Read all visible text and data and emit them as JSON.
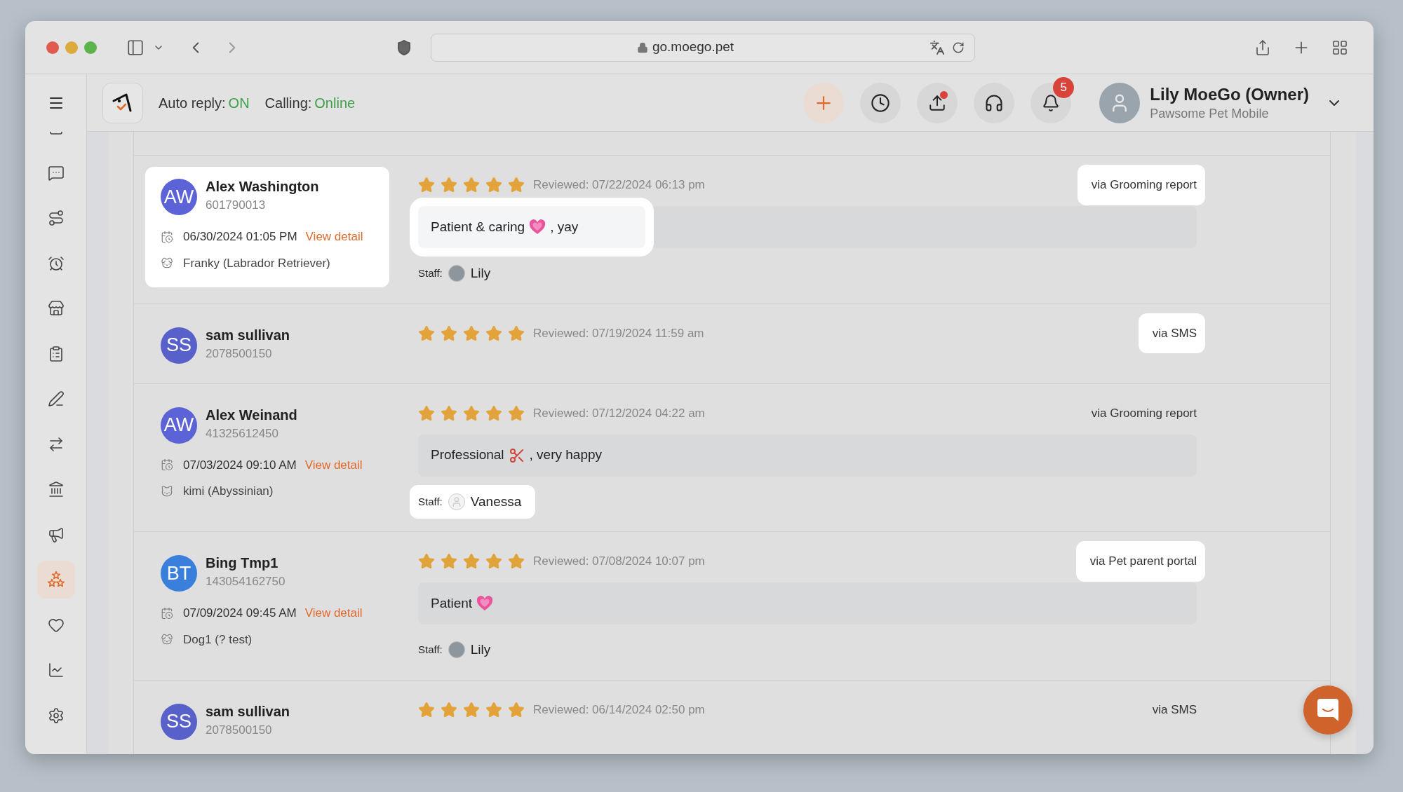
{
  "browser": {
    "url": "go.moego.pet"
  },
  "sidebar": {
    "items": [
      {
        "selected": false
      },
      {
        "selected": false
      },
      {
        "selected": false
      },
      {
        "selected": false
      },
      {
        "selected": false
      },
      {
        "selected": false
      },
      {
        "selected": false
      },
      {
        "selected": false
      },
      {
        "selected": false
      },
      {
        "selected": false
      },
      {
        "selected": true
      },
      {
        "selected": false
      },
      {
        "selected": false
      },
      {
        "selected": false
      }
    ]
  },
  "header": {
    "auto_reply": {
      "label": "Auto reply:",
      "value": "ON"
    },
    "calling": {
      "label": "Calling:",
      "value": "Online"
    },
    "upload_unread": true,
    "notifications_count": "5",
    "user": {
      "name": "Lily MoeGo (Owner)",
      "business": "Pawsome Pet Mobile"
    }
  },
  "reviews": [
    {
      "initials": "AW",
      "color": "#5b63d6",
      "name": "Alex Washington",
      "phone": "601790013",
      "appointment": {
        "date": "06/30/2024 01:05 PM",
        "link": "View detail"
      },
      "pet": {
        "kind": "dog",
        "name": "Franky (Labrador Retriever)"
      },
      "stars": 5,
      "reviewed": "Reviewed: 07/22/2024 06:13 pm",
      "source": "via Grooming report",
      "comment": [
        {
          "kind": "text",
          "text": "Patient & caring"
        },
        {
          "kind": "heart"
        },
        {
          "kind": "text",
          "text": ", yay"
        }
      ],
      "staff": {
        "label": "Staff:",
        "kind": "photo",
        "name": "Lily"
      },
      "card_highlighted": true,
      "comment_highlighted": true,
      "source_highlighted": true,
      "staff_highlighted": false
    },
    {
      "initials": "SS",
      "color": "#5860c9",
      "name": "sam sullivan",
      "phone": "2078500150",
      "stars": 5,
      "reviewed": "Reviewed: 07/19/2024 11:59 am",
      "source": "via SMS",
      "card_highlighted": false,
      "source_highlighted": true
    },
    {
      "initials": "AW",
      "color": "#5b63d6",
      "name": "Alex Weinand",
      "phone": "41325612450",
      "appointment": {
        "date": "07/03/2024 09:10 AM",
        "link": "View detail"
      },
      "pet": {
        "kind": "cat",
        "name": "kimi (Abyssinian)"
      },
      "stars": 5,
      "reviewed": "Reviewed: 07/12/2024 04:22 am",
      "source": "via Grooming report",
      "comment": [
        {
          "kind": "text",
          "text": "Professional"
        },
        {
          "kind": "scissors"
        },
        {
          "kind": "text",
          "text": ", very happy"
        }
      ],
      "staff": {
        "label": "Staff:",
        "kind": "default",
        "name": "Vanessa"
      },
      "card_highlighted": false,
      "comment_highlighted": false,
      "source_highlighted": false,
      "staff_highlighted": true
    },
    {
      "initials": "BT",
      "color": "#3a7fdc",
      "name": "Bing Tmp1",
      "phone": "143054162750",
      "appointment": {
        "date": "07/09/2024 09:45 AM",
        "link": "View detail"
      },
      "pet": {
        "kind": "dog",
        "name": "Dog1 (? test)"
      },
      "stars": 5,
      "reviewed": "Reviewed: 07/08/2024 10:07 pm",
      "source": "via Pet parent portal",
      "comment": [
        {
          "kind": "text",
          "text": "Patient"
        },
        {
          "kind": "heart"
        }
      ],
      "staff": {
        "label": "Staff:",
        "kind": "photo",
        "name": "Lily"
      },
      "card_highlighted": false,
      "comment_highlighted": false,
      "source_highlighted": true,
      "staff_highlighted": false
    },
    {
      "initials": "SS",
      "color": "#5860c9",
      "name": "sam sullivan",
      "phone": "2078500150",
      "stars": 5,
      "reviewed": "Reviewed: 06/14/2024 02:50 pm",
      "source": "via SMS",
      "card_highlighted": false,
      "source_highlighted": false
    }
  ]
}
